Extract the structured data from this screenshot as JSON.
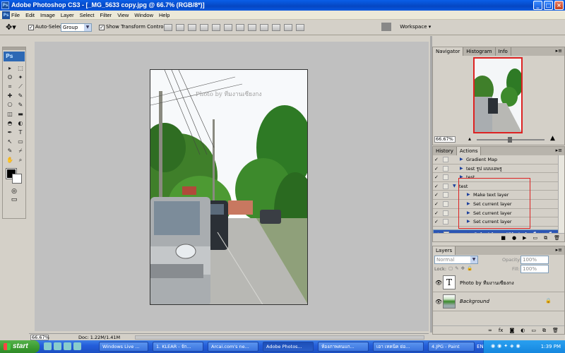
{
  "window": {
    "title": "Adobe Photoshop CS3 - [_MG_5633 copy.jpg @ 66.7% (RGB/8*)]",
    "buttons": [
      "minimize",
      "maximize",
      "close"
    ]
  },
  "menubar": [
    "File",
    "Edit",
    "Image",
    "Layer",
    "Select",
    "Filter",
    "View",
    "Window",
    "Help"
  ],
  "options": {
    "auto_select_label": "Auto-Select:",
    "auto_select_value": "Group",
    "show_transform_label": "Show Transform Controls",
    "workspace_label": "Workspace"
  },
  "toolbox": {
    "badge": "Ps",
    "tools": [
      "move-icon",
      "marquee-icon",
      "lasso-icon",
      "magic-wand-icon",
      "crop-icon",
      "slice-icon",
      "heal-icon",
      "brush-icon",
      "stamp-icon",
      "history-brush-icon",
      "eraser-icon",
      "gradient-icon",
      "blur-icon",
      "dodge-icon",
      "pen-icon",
      "type-icon",
      "path-select-icon",
      "shape-icon",
      "notes-icon",
      "eyedropper-icon",
      "hand-icon",
      "zoom-icon"
    ],
    "tool_glyphs": [
      "▸",
      "⬚",
      "ʘ",
      "✦",
      "⌗",
      "⟋",
      "✚",
      "✎",
      "⎔",
      "✎",
      "◫",
      "▬",
      "◓",
      "◐",
      "✒",
      "T",
      "↖",
      "▭",
      "✎",
      "⌿",
      "✋",
      "⌕"
    ]
  },
  "document": {
    "watermark": "Photo by ทีมงานเซียงกง",
    "zoom": "66.67%",
    "doc_info": "Doc: 1.22M/1.41M"
  },
  "navigator": {
    "tabs": [
      "Navigator",
      "Histogram",
      "Info"
    ],
    "zoom": "66.67%"
  },
  "actions": {
    "tabs": [
      "History",
      "Actions"
    ],
    "rows": [
      {
        "label": "Gradient Map",
        "indent": 1,
        "expanded": false,
        "selected": false
      },
      {
        "label": "test รูป แบบเอพรู",
        "indent": 1,
        "expanded": false,
        "selected": false
      },
      {
        "label": "test",
        "indent": 1,
        "expanded": false,
        "selected": false
      },
      {
        "label": "test",
        "indent": 0,
        "expanded": true,
        "selected": false
      },
      {
        "label": "Make text layer",
        "indent": 2,
        "expanded": false,
        "selected": false
      },
      {
        "label": "Set current layer",
        "indent": 2,
        "expanded": false,
        "selected": false
      },
      {
        "label": "Set current layer",
        "indent": 2,
        "expanded": false,
        "selected": false
      },
      {
        "label": "Set current layer",
        "indent": 2,
        "expanded": false,
        "selected": false
      },
      {
        "label": "Select layer \"Photo by ทีมงานเซียงง...",
        "indent": 2,
        "expanded": false,
        "selected": true
      }
    ]
  },
  "layers": {
    "tab": "Layers",
    "blend_mode": "Normal",
    "opacity_label": "Opacity:",
    "opacity_value": "100%",
    "lock_label": "Lock:",
    "fill_label": "Fill:",
    "fill_value": "100%",
    "items": [
      {
        "name": "Photo by ทีมงานเซียงกง",
        "type": "text",
        "thumb": "T"
      },
      {
        "name": "Background",
        "type": "image",
        "thumb": ""
      }
    ]
  },
  "taskbar": {
    "start": "start",
    "items": [
      {
        "label": "Windows Live ...",
        "active": false
      },
      {
        "label": "1. KLEAR - จัก...",
        "active": false
      },
      {
        "label": "Arcai.com's ne...",
        "active": false
      },
      {
        "label": "Adobe Photos...",
        "active": true
      },
      {
        "label": "ห้องภาพคนแก...",
        "active": false
      },
      {
        "label": "เอา เทคนิค ย่อ...",
        "active": false
      },
      {
        "label": "4.JPG - Paint",
        "active": false
      }
    ],
    "language": "EN",
    "clock": "1:39 PM"
  },
  "colors": {
    "titlebar": "#0a5fe8",
    "selection": "#2b55b4",
    "annotation_red": "#dd2222"
  }
}
